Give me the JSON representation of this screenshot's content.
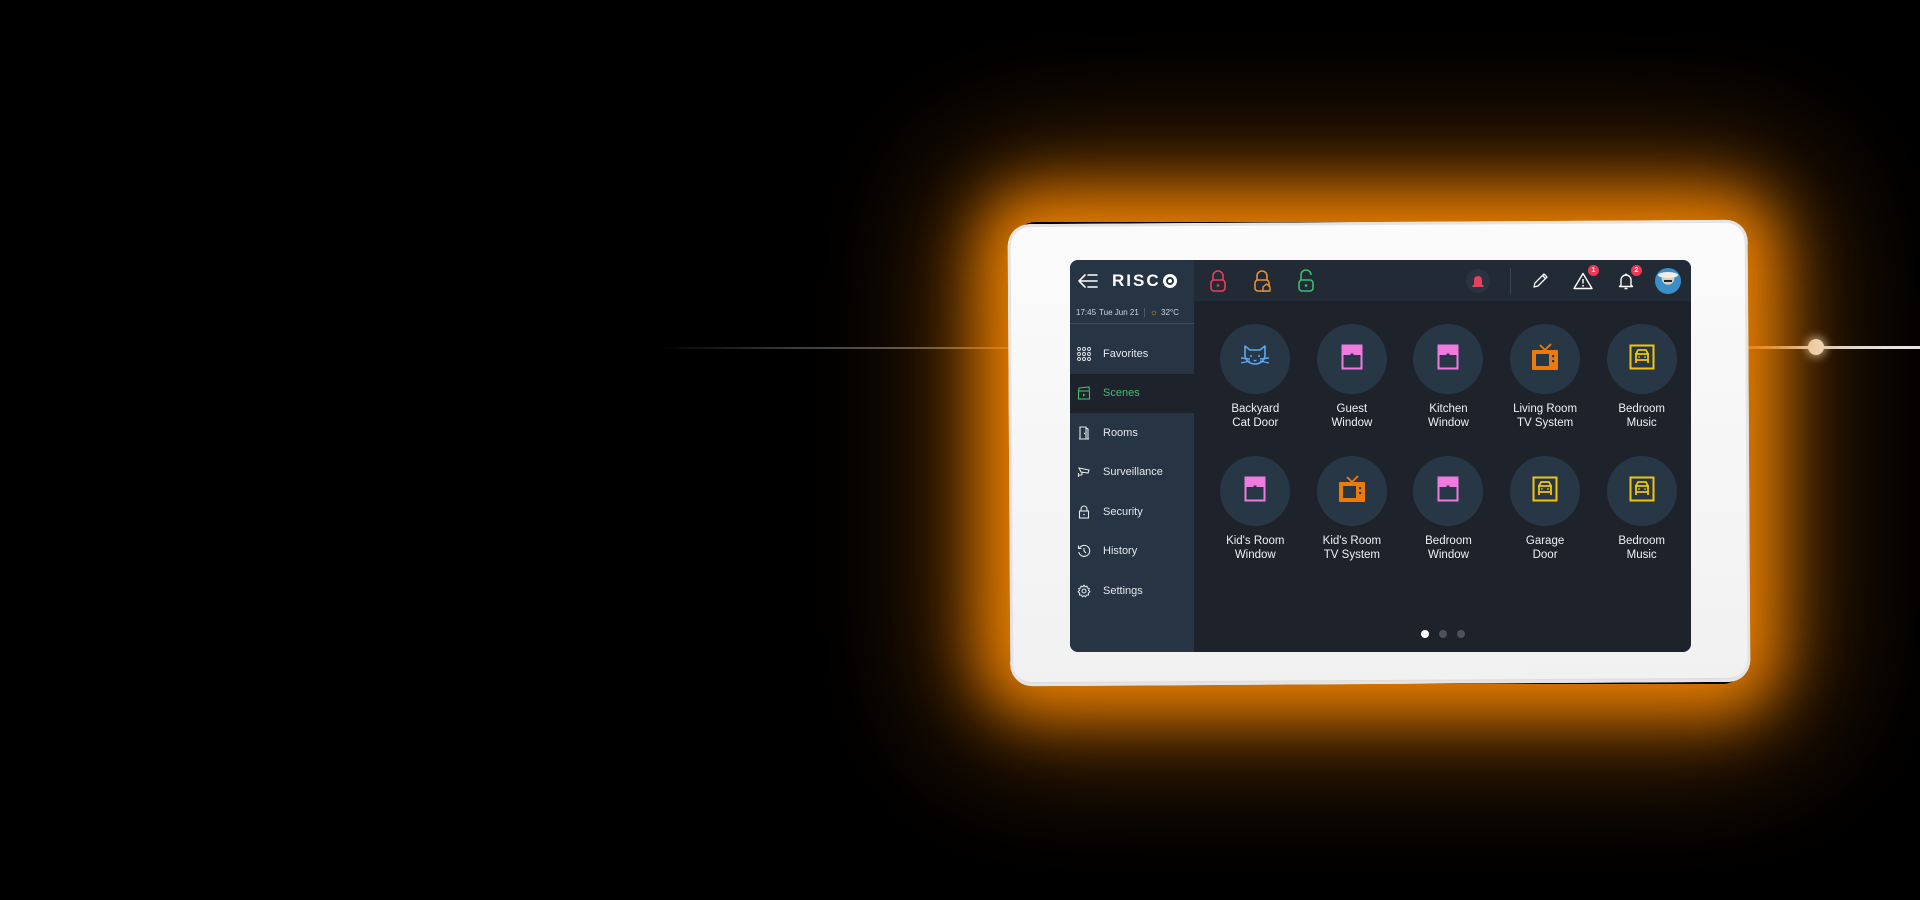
{
  "header": {
    "logo_text": "RISC",
    "time": "17:45",
    "date": "Tue Jun 21",
    "temperature": "32°C",
    "weather_icon": "sun-icon"
  },
  "quick_actions": [
    {
      "name": "arm-lock-button",
      "icon": "lock-closed-icon",
      "color": "#e8405a"
    },
    {
      "name": "home-arm-lock-button",
      "icon": "lock-home-icon",
      "color": "#e7913a"
    },
    {
      "name": "disarm-lock-button",
      "icon": "lock-open-icon",
      "color": "#3cbf6d"
    }
  ],
  "toolbar": {
    "siren_icon": "siren-icon",
    "edit_icon": "pencil-icon",
    "alerts_badge": "1",
    "notifications_badge": "2",
    "avatar": "user-avatar"
  },
  "sidebar": {
    "items": [
      {
        "label": "Favorites",
        "icon": "grid-dots-icon",
        "active": false
      },
      {
        "label": "Scenes",
        "icon": "clapperboard-icon",
        "active": true
      },
      {
        "label": "Rooms",
        "icon": "door-icon",
        "active": false
      },
      {
        "label": "Surveillance",
        "icon": "camera-icon",
        "active": false
      },
      {
        "label": "Security",
        "icon": "padlock-icon",
        "active": false
      },
      {
        "label": "History",
        "icon": "history-icon",
        "active": false
      },
      {
        "label": "Settings",
        "icon": "gear-icon",
        "active": false
      }
    ]
  },
  "scenes": [
    {
      "label": "Backyard\nCat Door",
      "icon": "cat-icon",
      "color": "#5aa8ef"
    },
    {
      "label": "Guest\nWindow",
      "icon": "window-icon",
      "color": "#f07ae0"
    },
    {
      "label": "Kitchen\nWindow",
      "icon": "window-icon",
      "color": "#f07ae0"
    },
    {
      "label": "Living Room\nTV System",
      "icon": "tv-icon",
      "color": "#ec7a0c"
    },
    {
      "label": "Bedroom\nMusic",
      "icon": "garage-car-icon",
      "color": "#f1c40f"
    },
    {
      "label": "Kid's Room\nWindow",
      "icon": "window-icon",
      "color": "#f07ae0"
    },
    {
      "label": "Kid's Room\nTV System",
      "icon": "tv-icon",
      "color": "#ec7a0c"
    },
    {
      "label": "Bedroom\nWindow",
      "icon": "window-icon",
      "color": "#f07ae0"
    },
    {
      "label": "Garage\nDoor",
      "icon": "garage-car-icon",
      "color": "#f1c40f"
    },
    {
      "label": "Bedroom\nMusic",
      "icon": "garage-car-icon",
      "color": "#f1c40f"
    }
  ],
  "pager": {
    "pages": 3,
    "current": 1
  },
  "accent_colors": {
    "active_nav": "#3fbf73",
    "badge": "#ea3a55",
    "glow": "#ff8c00"
  }
}
